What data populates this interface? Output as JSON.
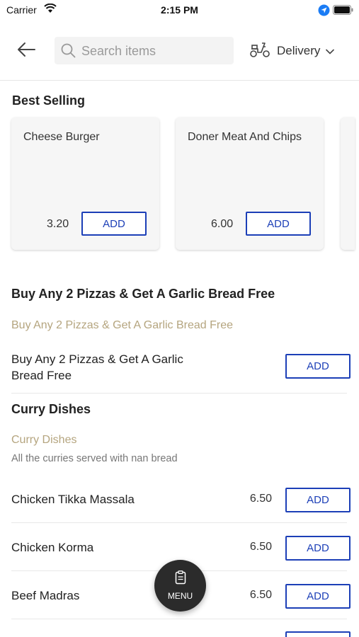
{
  "status_bar": {
    "carrier": "Carrier",
    "time": "2:15 PM"
  },
  "header": {
    "search_placeholder": "Search items",
    "delivery_label": "Delivery",
    "icons": [
      "back-arrow-icon",
      "search-icon",
      "scooter-icon",
      "chevron-down-icon"
    ]
  },
  "best_selling": {
    "title": "Best Selling",
    "items": [
      {
        "name": "Cheese Burger",
        "price": "3.20",
        "add_label": "ADD"
      },
      {
        "name": "Doner Meat And Chips",
        "price": "6.00",
        "add_label": "ADD"
      }
    ]
  },
  "pizza_offer": {
    "title": "Buy Any 2 Pizzas & Get A Garlic Bread Free",
    "subtitle": "Buy Any 2 Pizzas & Get A Garlic Bread Free",
    "items": [
      {
        "name_line1": "Buy Any 2 Pizzas & Get A Garlic",
        "name_line2": "Bread Free",
        "add_label": "ADD"
      }
    ]
  },
  "curry": {
    "title": "Curry Dishes",
    "subtitle": "Curry Dishes",
    "description": "All the curries served with nan bread",
    "items": [
      {
        "name": "Chicken Tikka Massala",
        "price": "6.50",
        "add_label": "ADD"
      },
      {
        "name": "Chicken Korma",
        "price": "6.50",
        "add_label": "ADD"
      },
      {
        "name": "Beef Madras",
        "price": "6.50",
        "add_label": "ADD"
      }
    ]
  },
  "menu_button": {
    "label": "MENU"
  },
  "colors": {
    "accent": "#1c3fb7",
    "subtitle": "#b5a57f",
    "fab": "#2b2b2b"
  }
}
